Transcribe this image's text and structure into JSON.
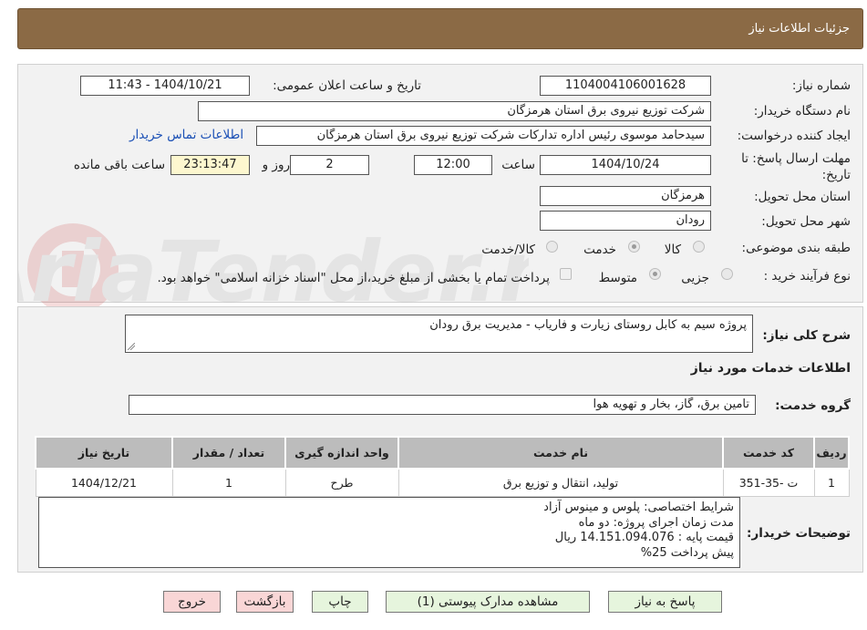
{
  "header": {
    "title": "جزئیات اطلاعات نیاز"
  },
  "need": {
    "number_label": "شماره نیاز:",
    "number_value": "1104004106001628",
    "announce_label": "تاریخ و ساعت اعلان عمومی:",
    "announce_value": "1404/10/21 - 11:43",
    "buyer_label": "نام دستگاه خریدار:",
    "buyer_value": "شرکت توزیع نیروی برق استان هرمزگان",
    "requester_label": "ایجاد کننده درخواست:",
    "requester_value": "سیدحامد موسوی رئیس اداره تدارکات شرکت توزیع نیروی برق استان هرمزگان",
    "contact_link": "اطلاعات تماس خریدار",
    "deadline_label_1": "مهلت ارسال پاسخ: تا",
    "deadline_label_2": "تاریخ:",
    "deadline_date": "1404/10/24",
    "time_label": "ساعت",
    "deadline_time": "12:00",
    "days_value": "2",
    "days_label": "روز و",
    "remaining_value": "23:13:47",
    "remaining_label": "ساعت باقی مانده",
    "province_label": "استان محل تحویل:",
    "province_value": "هرمزگان",
    "city_label": "شهر محل تحویل:",
    "city_value": "رودان",
    "category_label": "طبقه بندی موضوعی:",
    "category_options": [
      "کالا",
      "خدمت",
      "کالا/خدمت"
    ],
    "category_selected": "خدمت",
    "process_label": "نوع فرآیند خرید :",
    "process_options": [
      "جزیی",
      "متوسط"
    ],
    "process_selected": "متوسط",
    "treasury_text": "پرداخت تمام یا بخشی از مبلغ خرید،از محل \"اسناد خزانه اسلامی\" خواهد بود."
  },
  "description": {
    "label": "شرح کلی نیاز:",
    "value": "پروژه سیم به کابل روستای زیارت و فاریاب - مدیریت برق رودان"
  },
  "services": {
    "section_title": "اطلاعات خدمات مورد نیاز",
    "group_label": "گروه خدمت:",
    "group_value": "تامین برق، گاز، بخار و تهویه هوا",
    "columns": [
      "ردیف",
      "کد خدمت",
      "نام خدمت",
      "واحد اندازه گیری",
      "تعداد / مقدار",
      "تاریخ نیاز"
    ],
    "rows": [
      [
        "1",
        "ت -35-351",
        "تولید، انتقال و توزیع برق",
        "طرح",
        "1",
        "1404/12/21"
      ]
    ]
  },
  "buyer_notes": {
    "label": "توضیحات خریدار:",
    "lines": [
      "شرایط اختصاصی: پلوس و مینوس آزاد",
      "مدت زمان اجرای پروژه: دو ماه",
      "قیمت پایه : 14.151.094.076 ریال",
      "پیش پرداخت 25%"
    ]
  },
  "buttons": {
    "reply": "پاسخ به نیاز",
    "attachments": "مشاهده مدارک پیوستی (1)",
    "print": "چاپ",
    "back": "بازگشت",
    "exit": "خروج"
  },
  "watermark": {
    "text": "AriaTender.neT"
  },
  "colors": {
    "header_bg": "#8b6a45",
    "button_green": "#e6f5dd",
    "button_pink": "#f9d6d6",
    "link_blue": "#1a4fb5",
    "remaining_bg": "#fdf7cf"
  }
}
